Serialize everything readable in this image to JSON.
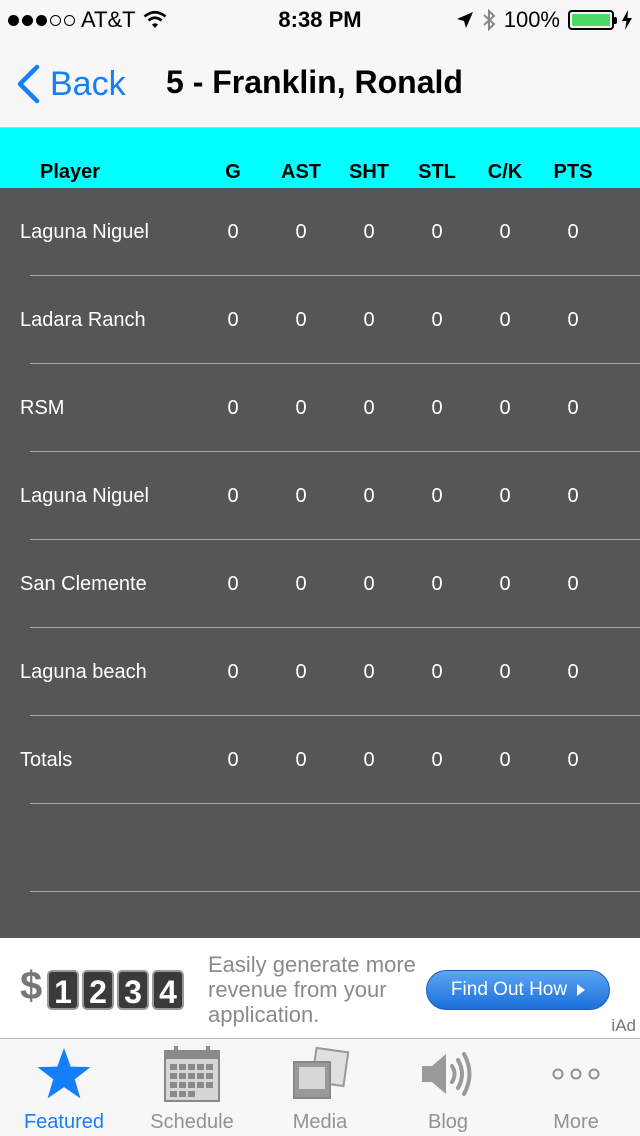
{
  "status_bar": {
    "carrier": "AT&T",
    "signal_bars_filled": 3,
    "signal_bars_total": 5,
    "time": "8:38 PM",
    "battery": "100%"
  },
  "nav": {
    "back_label": "Back",
    "title": "5 - Franklin, Ronald"
  },
  "table": {
    "columns": [
      "Player",
      "G",
      "AST",
      "SHT",
      "STL",
      "C/K",
      "PTS"
    ],
    "rows": [
      {
        "player": "Laguna Niguel",
        "values": [
          "0",
          "0",
          "0",
          "0",
          "0",
          "0"
        ]
      },
      {
        "player": "Ladara Ranch",
        "values": [
          "0",
          "0",
          "0",
          "0",
          "0",
          "0"
        ]
      },
      {
        "player": "RSM",
        "values": [
          "0",
          "0",
          "0",
          "0",
          "0",
          "0"
        ]
      },
      {
        "player": "Laguna Niguel",
        "values": [
          "0",
          "0",
          "0",
          "0",
          "0",
          "0"
        ]
      },
      {
        "player": "San Clemente",
        "values": [
          "0",
          "0",
          "0",
          "0",
          "0",
          "0"
        ]
      },
      {
        "player": "Laguna beach",
        "values": [
          "0",
          "0",
          "0",
          "0",
          "0",
          "0"
        ]
      },
      {
        "player": "Totals",
        "values": [
          "0",
          "0",
          "0",
          "0",
          "0",
          "0"
        ]
      }
    ]
  },
  "ad": {
    "currency": "$",
    "digits": [
      "1",
      "2",
      "3",
      "4"
    ],
    "tagline": "Easily generate more revenue from your application.",
    "button_label": "Find Out How",
    "badge": "iAd"
  },
  "tabbar": {
    "items": [
      {
        "label": "Featured",
        "icon": "star-icon",
        "active": true
      },
      {
        "label": "Schedule",
        "icon": "calendar-icon",
        "active": false
      },
      {
        "label": "Media",
        "icon": "photos-icon",
        "active": false
      },
      {
        "label": "Blog",
        "icon": "speaker-icon",
        "active": false
      },
      {
        "label": "More",
        "icon": "more-dots-icon",
        "active": false
      }
    ]
  },
  "colors": {
    "accent": "#157efb",
    "header_bg": "#00ffff",
    "table_bg": "#565656",
    "battery": "#4cd964"
  }
}
